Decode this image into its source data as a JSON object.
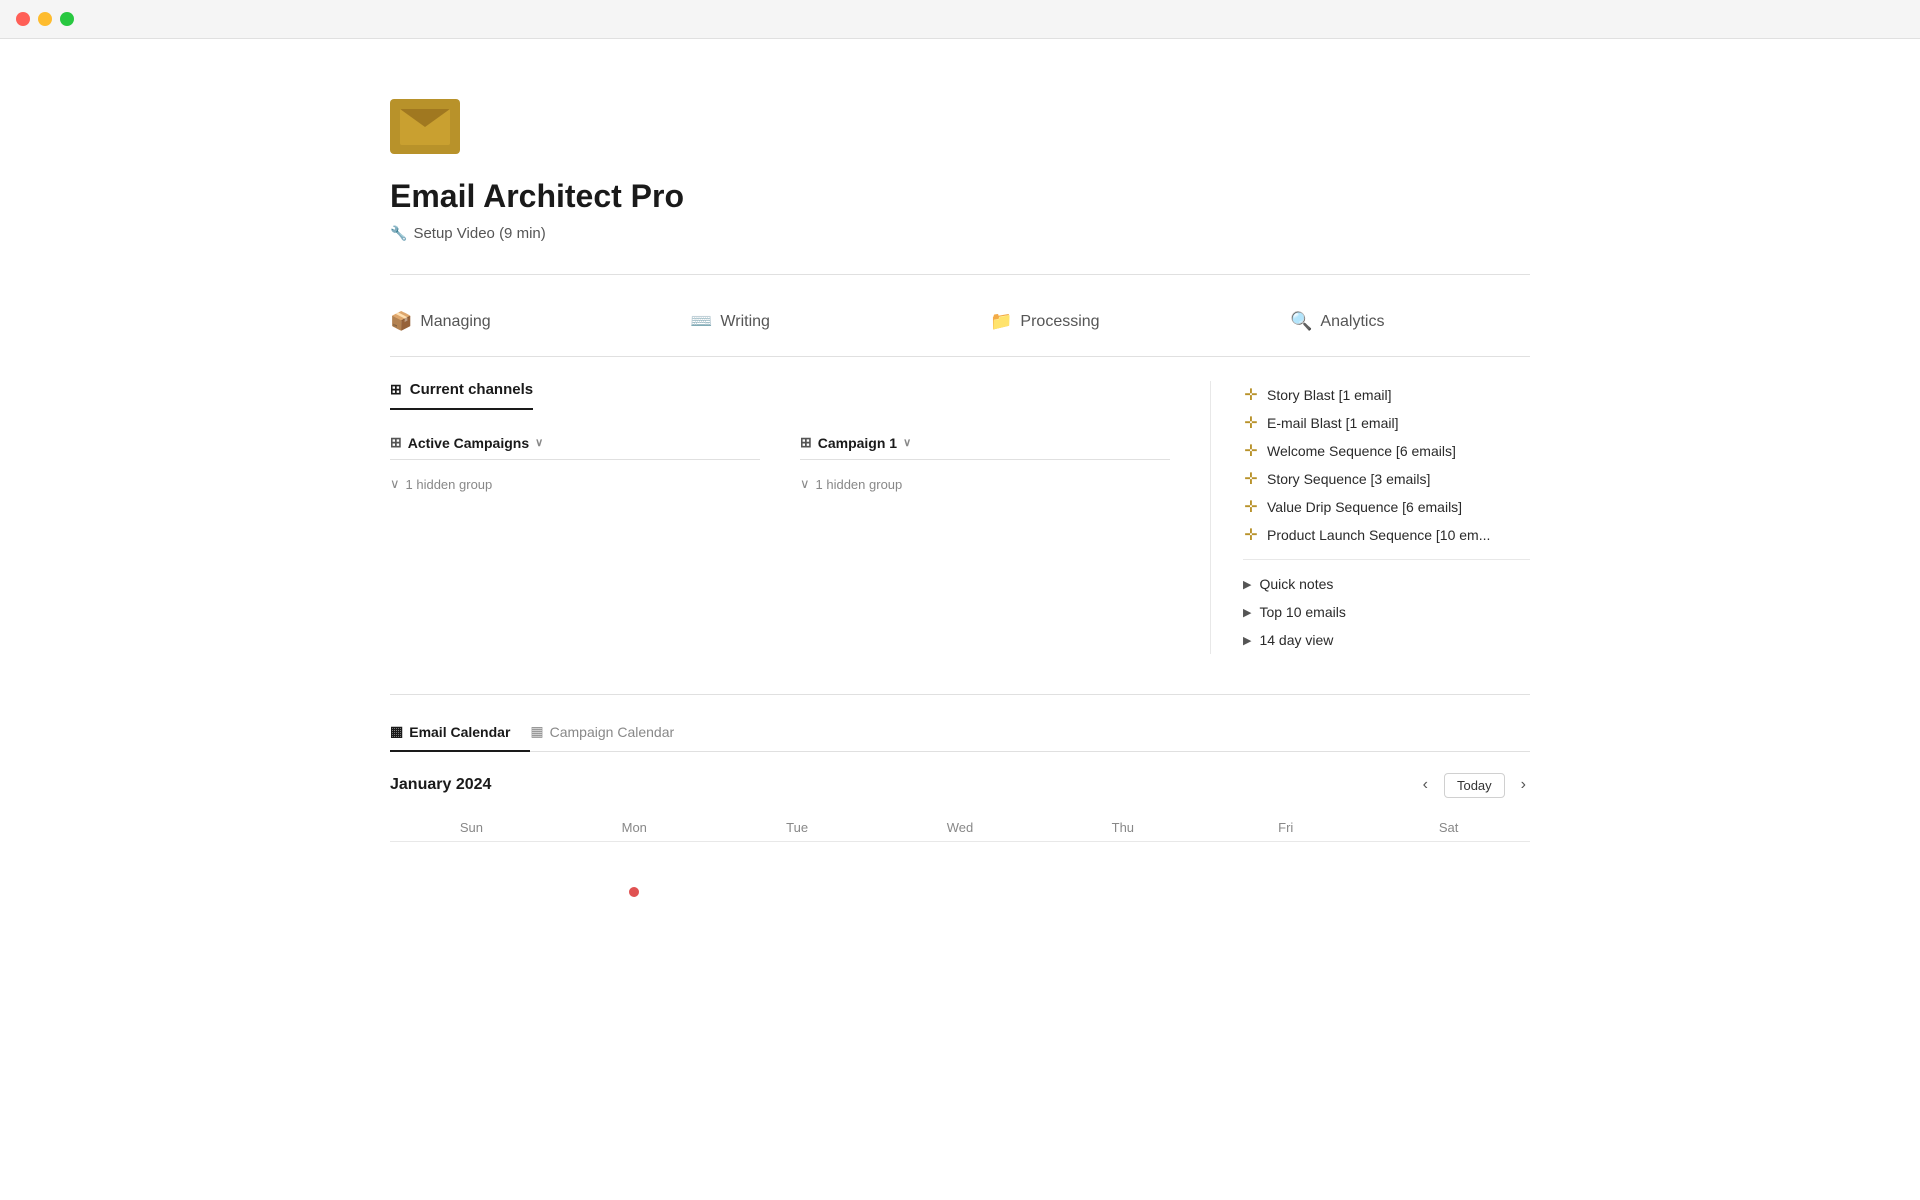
{
  "titlebar": {
    "traffic_lights": [
      "red",
      "yellow",
      "green"
    ]
  },
  "app": {
    "title": "Email Architect Pro",
    "setup_link": "Setup Video (9 min)"
  },
  "nav": {
    "items": [
      {
        "id": "managing",
        "label": "Managing",
        "icon": "📦"
      },
      {
        "id": "writing",
        "label": "Writing",
        "icon": "⌨️"
      },
      {
        "id": "processing",
        "label": "Processing",
        "icon": "📁"
      },
      {
        "id": "analytics",
        "label": "Analytics",
        "icon": "🔍"
      }
    ]
  },
  "current_channels": {
    "header": "Current channels",
    "boards": [
      {
        "id": "active-campaigns",
        "title": "Active Campaigns",
        "hidden_group": "1 hidden group"
      },
      {
        "id": "campaign-1",
        "title": "Campaign 1",
        "hidden_group": "1 hidden group"
      }
    ]
  },
  "sidebar": {
    "templates": [
      {
        "id": "story-blast",
        "label": "Story Blast [1 email]"
      },
      {
        "id": "email-blast",
        "label": "E-mail Blast [1 email]"
      },
      {
        "id": "welcome-sequence",
        "label": "Welcome Sequence [6 emails]"
      },
      {
        "id": "story-sequence",
        "label": "Story Sequence [3 emails]"
      },
      {
        "id": "value-drip",
        "label": "Value Drip Sequence [6 emails]"
      },
      {
        "id": "product-launch",
        "label": "Product Launch Sequence [10 em..."
      }
    ],
    "toggle_items": [
      {
        "id": "quick-notes",
        "label": "Quick notes"
      },
      {
        "id": "top-10-emails",
        "label": "Top 10 emails"
      },
      {
        "id": "14-day-view",
        "label": "14 day view"
      }
    ]
  },
  "calendar": {
    "tabs": [
      {
        "id": "email-calendar",
        "label": "Email Calendar",
        "active": true
      },
      {
        "id": "campaign-calendar",
        "label": "Campaign Calendar",
        "active": false
      }
    ],
    "month": "January 2024",
    "today_label": "Today",
    "day_headers": [
      "Sun",
      "Mon",
      "Tue",
      "Wed",
      "Thu",
      "Fri",
      "Sat"
    ]
  }
}
